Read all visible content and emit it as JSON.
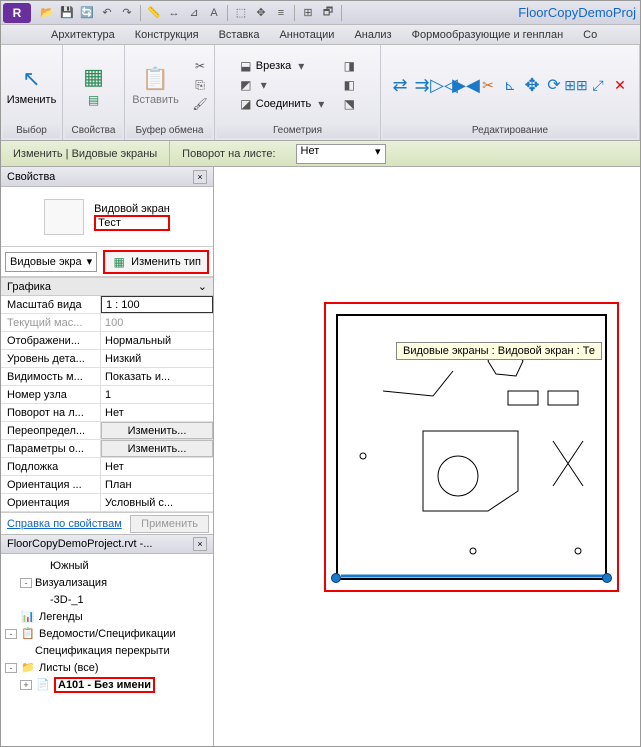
{
  "app": {
    "title": "FloorCopyDemoProj"
  },
  "tabs": [
    "Архитектура",
    "Конструкция",
    "Вставка",
    "Аннотации",
    "Анализ",
    "Формообразующие и генплан",
    "Со"
  ],
  "ribbon": {
    "modify": "Изменить",
    "cut": "Врезка",
    "paste": "Вставить",
    "join": "Соединить",
    "panels": {
      "sel": "Выбор",
      "prop": "Свойства",
      "clip": "Буфер обмена",
      "geom": "Геометрия",
      "edit": "Редактирование"
    }
  },
  "optionbar": {
    "context": "Изменить | Видовые экраны",
    "rotation_label": "Поворот на листе:",
    "rotation_value": "Нет"
  },
  "properties": {
    "title": "Свойства",
    "type_cat": "Видовой экран",
    "type_name": "Тест",
    "selector": "Видовые экра",
    "change_type": "Изменить тип",
    "group": "Графика",
    "rows": [
      {
        "k": "Масштаб вида",
        "v": "1 : 100",
        "kind": "inp"
      },
      {
        "k": "Текущий мас...",
        "v": "100",
        "kind": "gray"
      },
      {
        "k": "Отображени...",
        "v": "Нормальный"
      },
      {
        "k": "Уровень дета...",
        "v": "Низкий"
      },
      {
        "k": "Видимость м...",
        "v": "Показать и..."
      },
      {
        "k": "Номер узла",
        "v": "1"
      },
      {
        "k": "Поворот на л...",
        "v": "Нет"
      },
      {
        "k": "Переопредел...",
        "v": "Изменить...",
        "kind": "btn"
      },
      {
        "k": "Параметры о...",
        "v": "Изменить...",
        "kind": "btn"
      },
      {
        "k": "Подложка",
        "v": "Нет"
      },
      {
        "k": "Ориентация ...",
        "v": "План"
      },
      {
        "k": "Ориентация",
        "v": "Условный с..."
      }
    ],
    "help": "Справка по свойствам",
    "apply": "Применить"
  },
  "browser": {
    "title": "FloorCopyDemoProject.rvt -...",
    "items": [
      {
        "indent": 3,
        "label": "Южный",
        "icon": ""
      },
      {
        "indent": 1,
        "toggle": "-",
        "label": "Визуализация",
        "icon": ""
      },
      {
        "indent": 3,
        "label": "-3D-_1",
        "icon": ""
      },
      {
        "indent": 0,
        "toggle": "",
        "label": "Легенды",
        "icon": "📊",
        "color": "#c04b1e"
      },
      {
        "indent": 0,
        "toggle": "-",
        "label": "Ведомости/Спецификации",
        "icon": "📋",
        "color": "#c04b1e"
      },
      {
        "indent": 2,
        "label": "Спецификация перекрыти",
        "icon": ""
      },
      {
        "indent": 0,
        "toggle": "-",
        "label": "Листы (все)",
        "icon": "📁",
        "color": "#c9a92e"
      },
      {
        "indent": 1,
        "toggle": "+",
        "label": "A101 - Без имени",
        "icon": "📄",
        "bold": true,
        "red": true
      }
    ]
  },
  "tooltip": "Видовые экраны : Видовой экран : Те"
}
